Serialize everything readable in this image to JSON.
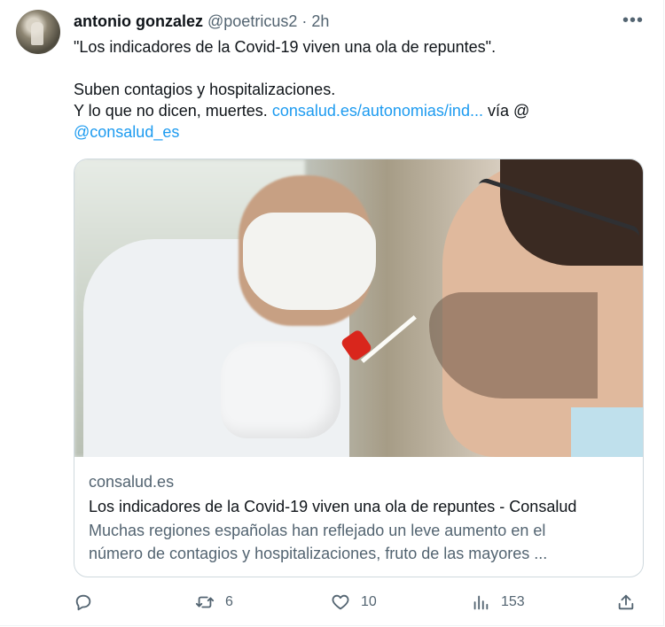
{
  "tweet": {
    "author_name": "antonio gonzalez",
    "handle": "@poetricus2",
    "separator": "·",
    "time": "2h",
    "more": "•••",
    "lines": [
      "\"Los indicadores de la Covid-19 viven una ola de repuntes\".",
      "Suben contagios y hospitalizaciones.",
      "Y lo que no dicen, muertes. "
    ],
    "link_text": "consalud.es/autonomias/ind...",
    "via_text": " vía @",
    "mention": "@consalud_es"
  },
  "card": {
    "domain": "consalud.es",
    "title": "Los indicadores de la Covid-19 viven una ola de repuntes - Consalud",
    "desc_line1": "Muchas regiones españolas han reflejado un leve aumento en el",
    "desc_line2": "número de contagios y hospitalizaciones, fruto de las mayores ...",
    "image_icon": "covid-test-photo"
  },
  "actions": {
    "reply_count": "",
    "retweet_count": "6",
    "like_count": "10",
    "views_count": "153"
  },
  "colors": {
    "link": "#1d9bf0",
    "muted": "#536471",
    "text": "#0f1419",
    "border": "#cfd9de"
  }
}
